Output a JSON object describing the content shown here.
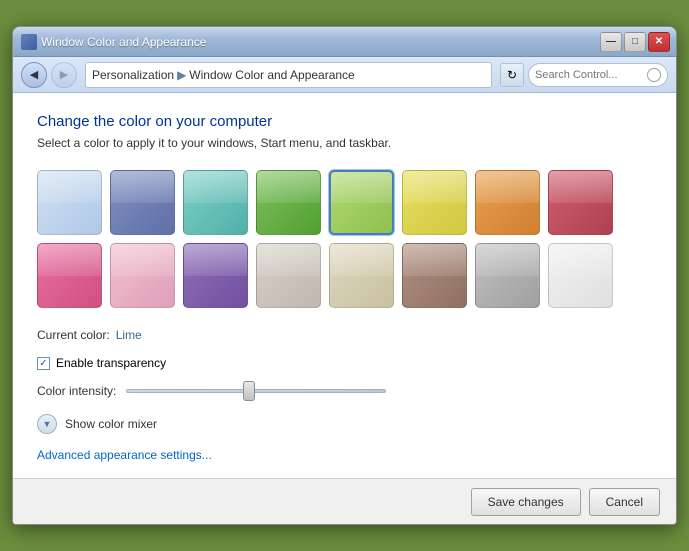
{
  "window": {
    "title": "Window Color and Appearance",
    "controls": {
      "minimize": "—",
      "maximize": "□",
      "close": "✕"
    }
  },
  "toolbar": {
    "back_label": "◀",
    "forward_label": "▶",
    "breadcrumb": {
      "root": "Personalization",
      "current": "Window Color and Appearance"
    },
    "refresh_label": "↻",
    "search_placeholder": "Search Control..."
  },
  "content": {
    "title": "Change the color on your computer",
    "subtitle": "Select a color to apply it to your windows, Start menu, and taskbar.",
    "current_color_label": "Current color:",
    "current_color_value": "Lime",
    "transparency_label": "Enable transparency",
    "intensity_label": "Color intensity:",
    "mixer_label": "Show color mixer",
    "advanced_link": "Advanced appearance settings...",
    "colors": [
      {
        "name": "sky",
        "gradient": "linear-gradient(135deg, #d0e0f0, #b0c8e8)",
        "selected": false
      },
      {
        "name": "twilight",
        "gradient": "linear-gradient(135deg, #8090c0, #6070a8)",
        "selected": false
      },
      {
        "name": "sea",
        "gradient": "linear-gradient(135deg, #80d0c8, #50b0a8)",
        "selected": false
      },
      {
        "name": "leaf",
        "gradient": "linear-gradient(135deg, #80c060, #50a030)",
        "selected": false
      },
      {
        "name": "lime",
        "gradient": "linear-gradient(135deg, #b0d870, #90c050)",
        "selected": true
      },
      {
        "name": "citrus",
        "gradient": "linear-gradient(135deg, #e8e060, #d0c840)",
        "selected": false
      },
      {
        "name": "pumpkin",
        "gradient": "linear-gradient(135deg, #e8a050, #d08030)",
        "selected": false
      },
      {
        "name": "ruby",
        "gradient": "linear-gradient(135deg, #d06070, #b04050)",
        "selected": false
      },
      {
        "name": "pink",
        "gradient": "linear-gradient(135deg, #e870a0, #d05080)",
        "selected": false
      },
      {
        "name": "blush",
        "gradient": "linear-gradient(135deg, #f0c0d0, #e0a0b8)",
        "selected": false
      },
      {
        "name": "lavender",
        "gradient": "linear-gradient(135deg, #9070b8, #7050a0)",
        "selected": false
      },
      {
        "name": "frost",
        "gradient": "linear-gradient(135deg, #d8d0c8, #c0b8b0)",
        "selected": false
      },
      {
        "name": "sand",
        "gradient": "linear-gradient(135deg, #e0d8c0, #c8c0a0)",
        "selected": false
      },
      {
        "name": "caramel",
        "gradient": "linear-gradient(135deg, #b09080, #907060)",
        "selected": false
      },
      {
        "name": "smoke",
        "gradient": "linear-gradient(135deg, #c0c0c0, #a0a0a0)",
        "selected": false
      },
      {
        "name": "pearl",
        "gradient": "linear-gradient(135deg, #f0f0f0, #e0e0e0)",
        "selected": false
      }
    ]
  },
  "footer": {
    "save_label": "Save changes",
    "cancel_label": "Cancel"
  }
}
